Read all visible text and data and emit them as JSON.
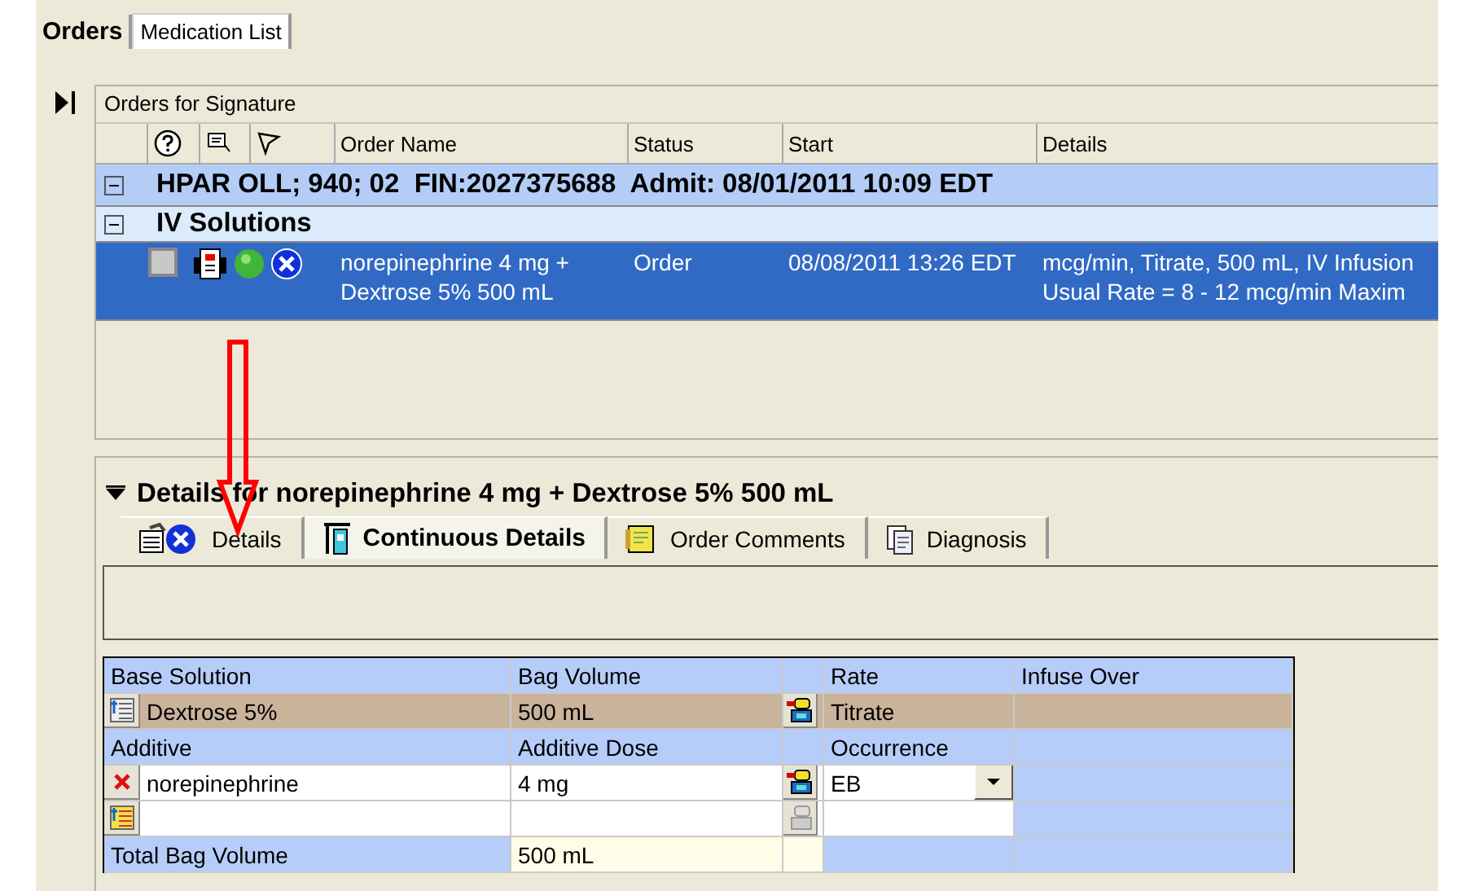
{
  "tabs": [
    {
      "label": "Orders",
      "selected": true
    },
    {
      "label": "Medication List",
      "selected": false
    }
  ],
  "orders_panel": {
    "title": "Orders for Signature",
    "columns": [
      "Order Name",
      "Status",
      "Start",
      "Details"
    ],
    "groups": [
      {
        "kind": "patient",
        "label": "HPAR OLL; 940; 02  FIN:2027375688  Admit: 08/01/2011 10:09 EDT",
        "expanded": true
      },
      {
        "kind": "category",
        "label": "IV Solutions",
        "expanded": true
      }
    ],
    "rows": [
      {
        "checked": false,
        "selected": true,
        "order_name": "norepinephrine 4 mg + Dextrose 5% 500 mL",
        "status": "Order",
        "start": "08/08/2011 13:26 EDT",
        "details": [
          "mcg/min, Titrate, 500 mL, IV Infusion",
          "Usual Rate = 8 - 12 mcg/min  Maxim"
        ]
      }
    ]
  },
  "details_panel": {
    "title": "Details for norepinephrine 4 mg + Dextrose 5% 500 mL",
    "expanded": true,
    "tabs": [
      {
        "label": "Details",
        "selected": false
      },
      {
        "label": "Continuous Details",
        "selected": true
      },
      {
        "label": "Order Comments",
        "selected": false
      },
      {
        "label": "Diagnosis",
        "selected": false
      }
    ],
    "base_solution": {
      "headers": [
        "Base Solution",
        "Bag Volume",
        "Rate",
        "Infuse Over"
      ],
      "name": "Dextrose 5%",
      "bag_volume": "500 mL",
      "rate": "Titrate"
    },
    "additives": {
      "headers": [
        "Additive",
        "Additive Dose",
        "Occurrence"
      ],
      "rows": [
        {
          "name": "norepinephrine",
          "dose": "4 mg",
          "occurrence": "EB"
        }
      ]
    },
    "total": {
      "label": "Total Bag Volume",
      "value": "500 mL"
    }
  }
}
